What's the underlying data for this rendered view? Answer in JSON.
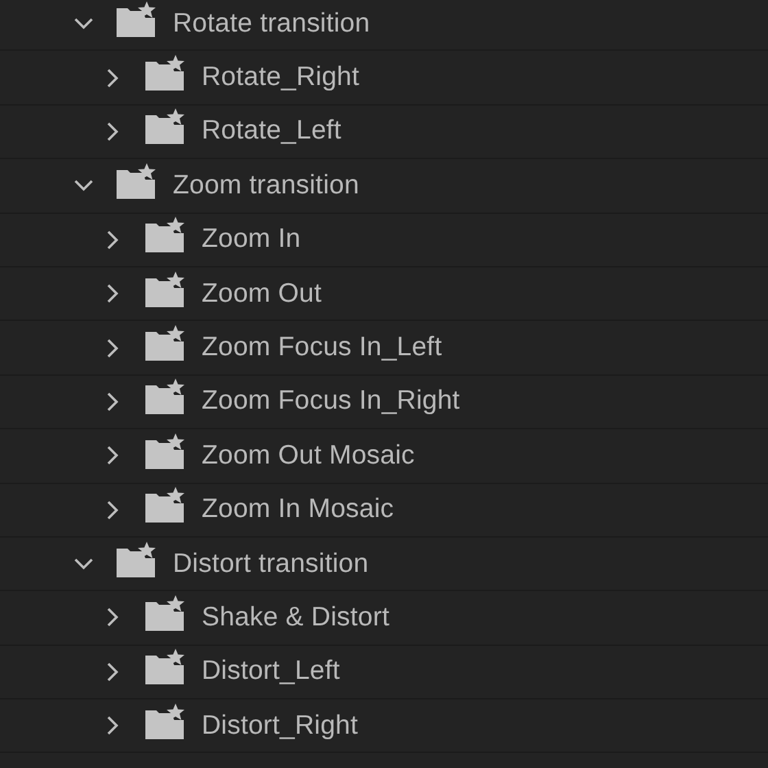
{
  "tree": [
    {
      "label": "Rotate transition",
      "expanded": true,
      "children": [
        {
          "label": "Rotate_Right",
          "expanded": false
        },
        {
          "label": "Rotate_Left",
          "expanded": false
        }
      ]
    },
    {
      "label": "Zoom transition",
      "expanded": true,
      "children": [
        {
          "label": "Zoom In",
          "expanded": false
        },
        {
          "label": "Zoom Out",
          "expanded": false
        },
        {
          "label": "Zoom Focus In_Left",
          "expanded": false
        },
        {
          "label": "Zoom Focus In_Right",
          "expanded": false
        },
        {
          "label": "Zoom Out Mosaic",
          "expanded": false
        },
        {
          "label": "Zoom In Mosaic",
          "expanded": false
        }
      ]
    },
    {
      "label": "Distort transition",
      "expanded": true,
      "children": [
        {
          "label": "Shake & Distort",
          "expanded": false
        },
        {
          "label": "Distort_Left",
          "expanded": false
        },
        {
          "label": "Distort_Right",
          "expanded": false
        }
      ]
    }
  ]
}
